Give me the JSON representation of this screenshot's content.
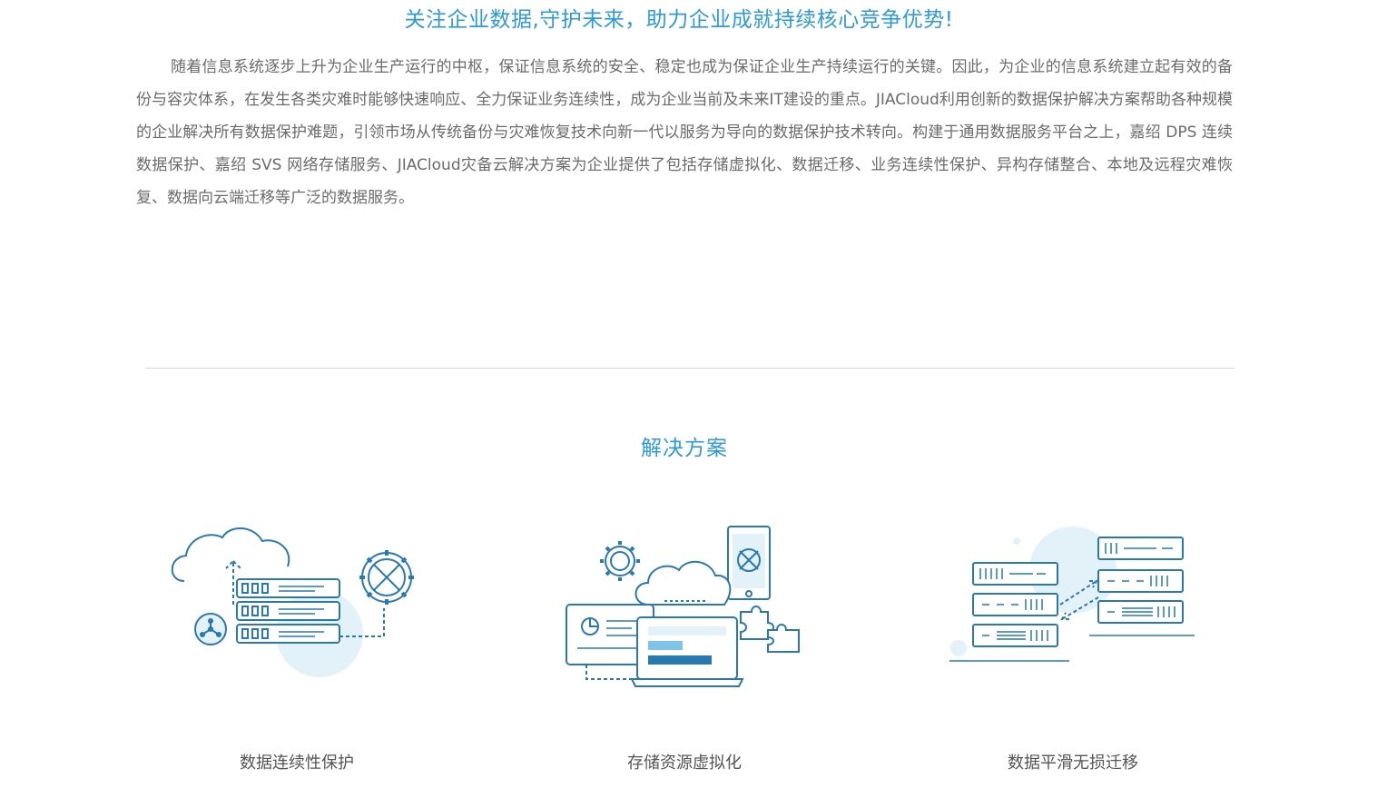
{
  "headline": "关注企业数据,守护未来，助力企业成就持续核心竞争优势!",
  "intro": "随着信息系统逐步上升为企业生产运行的中枢，保证信息系统的安全、稳定也成为保证企业生产持续运行的关键。因此，为企业的信息系统建立起有效的备份与容灾体系，在发生各类灾难时能够快速响应、全力保证业务连续性，成为企业当前及未来IT建设的重点。JIACloud利用创新的数据保护解决方案帮助各种规模的企业解决所有数据保护难题，引领市场从传统备份与灾难恢复技术向新一代以服务为导向的数据保护技术转向。构建于通用数据服务平台之上，嘉绍 DPS 连续数据保护、嘉绍 SVS 网络存储服务、JIACloud灾备云解决方案为企业提供了包括存储虚拟化、数据迁移、业务连续性保护、异构存储整合、本地及远程灾难恢复、数据向云端迁移等广泛的数据服务。",
  "solutions": {
    "title": "解决方案",
    "items": [
      {
        "label": "数据连续性保护",
        "icon": "cloud-server-gear-icon"
      },
      {
        "label": "存储资源虚拟化",
        "icon": "cloud-devices-puzzle-icon"
      },
      {
        "label": "数据平滑无损迁移",
        "icon": "server-migration-icon"
      }
    ]
  },
  "colors": {
    "accent": "#2f9ad6",
    "line": "#2a78b0",
    "tint": "#e3f1f9",
    "text": "#6b6b6b"
  }
}
